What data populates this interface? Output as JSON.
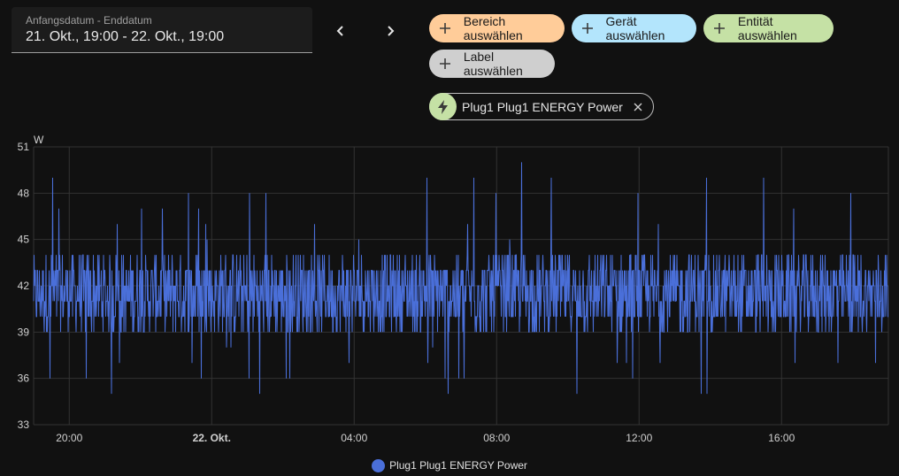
{
  "date_picker": {
    "label": "Anfangsdatum - Enddatum",
    "value": "21. Okt., 19:00 - 22. Okt., 19:00"
  },
  "nav": {
    "prev_icon": "chevron-left-icon",
    "next_icon": "chevron-right-icon"
  },
  "filters": {
    "area": {
      "label": "Bereich auswählen",
      "color": "#ffcc99"
    },
    "device": {
      "label": "Gerät auswählen",
      "color": "#b3e5fc"
    },
    "entity": {
      "label": "Entität auswählen",
      "color": "#c5e1a5"
    },
    "label": {
      "label": "Label auswählen",
      "color": "#cfcfcf"
    }
  },
  "selected_entity": {
    "name": "Plug1 Plug1 ENERGY Power",
    "icon": "lightning-bolt-icon"
  },
  "colors": {
    "series": "#4a6fd9",
    "grid": "#333333",
    "background": "#111111"
  },
  "chart_data": {
    "type": "line",
    "ylabel": "W",
    "ylim": [
      33,
      51
    ],
    "yticks": [
      33,
      36,
      39,
      42,
      45,
      48,
      51
    ],
    "x_range": [
      "21. Okt. 19:00",
      "22. Okt. 19:00"
    ],
    "xticks": [
      {
        "label": "20:00",
        "bold": false
      },
      {
        "label": "22. Okt.",
        "bold": true
      },
      {
        "label": "04:00",
        "bold": false
      },
      {
        "label": "08:00",
        "bold": false
      },
      {
        "label": "12:00",
        "bold": false
      },
      {
        "label": "16:00",
        "bold": false
      }
    ],
    "grid": true,
    "legend_position": "bottom-center",
    "series": [
      {
        "name": "Plug1 Plug1 ENERGY Power",
        "color": "#4a6fd9",
        "typical_range": [
          39,
          44
        ],
        "min": 35,
        "max": 51
      }
    ]
  }
}
